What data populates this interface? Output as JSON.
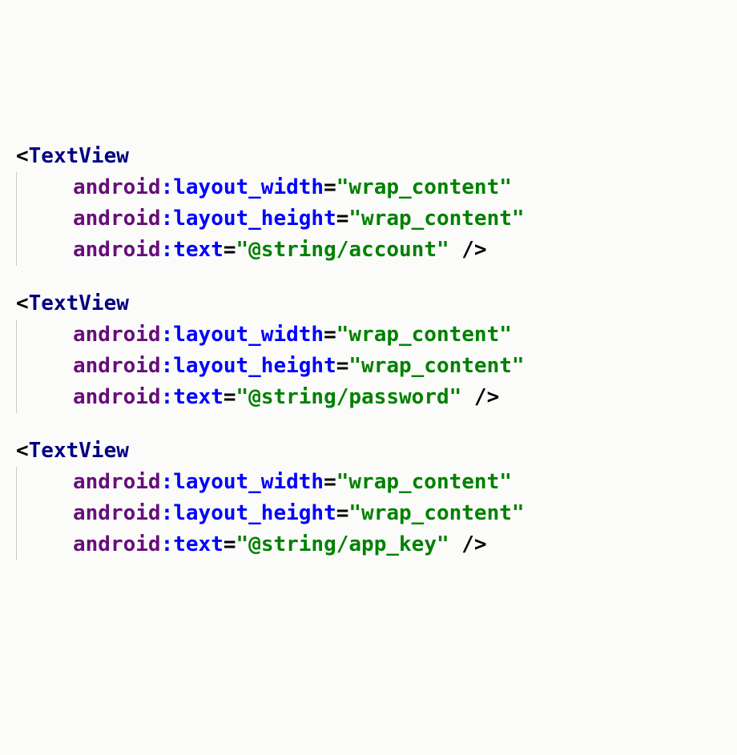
{
  "code": {
    "tagName": "TextView",
    "blocks": [
      {
        "attrs": [
          {
            "ns": "android",
            "name": "layout_width",
            "value": "\"wrap_content\""
          },
          {
            "ns": "android",
            "name": "layout_height",
            "value": "\"wrap_content\""
          },
          {
            "ns": "android",
            "name": "text",
            "value": "\"@string/account\""
          }
        ]
      },
      {
        "attrs": [
          {
            "ns": "android",
            "name": "layout_width",
            "value": "\"wrap_content\""
          },
          {
            "ns": "android",
            "name": "layout_height",
            "value": "\"wrap_content\""
          },
          {
            "ns": "android",
            "name": "text",
            "value": "\"@string/password\""
          }
        ]
      },
      {
        "attrs": [
          {
            "ns": "android",
            "name": "layout_width",
            "value": "\"wrap_content\""
          },
          {
            "ns": "android",
            "name": "layout_height",
            "value": "\"wrap_content\""
          },
          {
            "ns": "android",
            "name": "text",
            "value": "\"@string/app_key\""
          }
        ]
      }
    ]
  }
}
